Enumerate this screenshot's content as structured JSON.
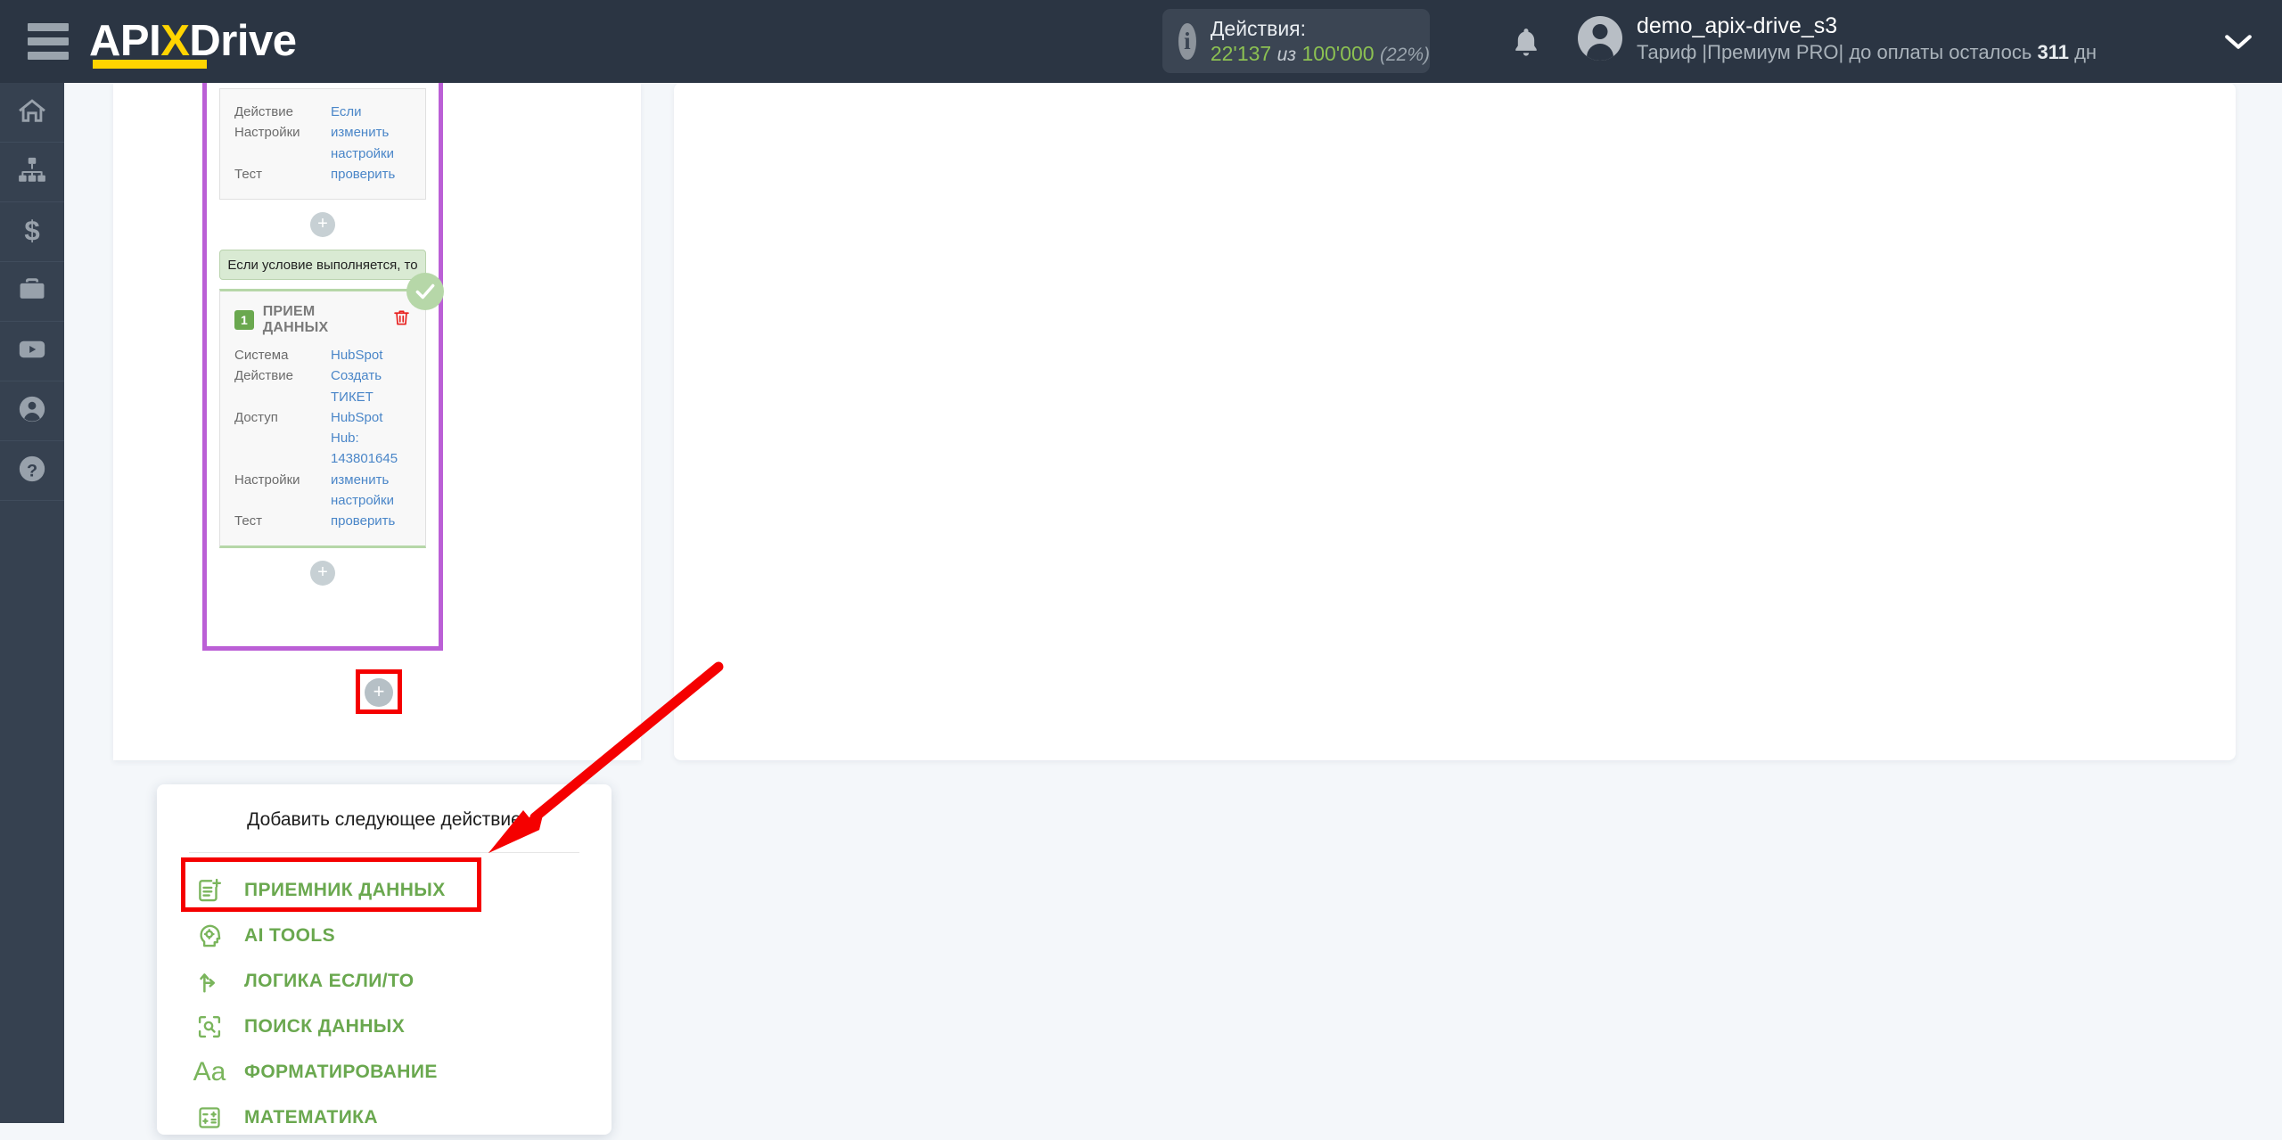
{
  "header": {
    "logo": {
      "part1": "API",
      "x": "X",
      "part2": "Drive"
    },
    "hamburger_icon": "hamburger-menu-icon",
    "actions": {
      "title": "Действия:",
      "used": "22'137",
      "separator": "из",
      "total": "100'000",
      "percent": "(22%)",
      "info_icon": "info-icon"
    },
    "bell_icon": "notification-bell-icon",
    "account": {
      "avatar_icon": "user-avatar-icon",
      "name": "demo_apix-drive_s3",
      "plan_prefix": "Тариф |Премиум PRO| до оплаты осталось ",
      "plan_days": "311",
      "plan_suffix": " дн",
      "caret_icon": "chevron-down-icon"
    }
  },
  "sidebar": {
    "items": [
      {
        "name": "home",
        "icon": "home-icon"
      },
      {
        "name": "connections",
        "icon": "sitemap-icon"
      },
      {
        "name": "billing",
        "icon": "dollar-icon"
      },
      {
        "name": "services",
        "icon": "briefcase-icon"
      },
      {
        "name": "video",
        "icon": "youtube-icon"
      },
      {
        "name": "profile",
        "icon": "user-icon"
      },
      {
        "name": "help",
        "icon": "question-circle-icon"
      }
    ]
  },
  "flow": {
    "if_node": {
      "rows": [
        {
          "key": "Действие",
          "value": "Если"
        },
        {
          "key": "Настройки",
          "value": "изменить настройки"
        },
        {
          "key": "Тест",
          "value": "проверить"
        }
      ]
    },
    "add_inside_top_label": "+",
    "condition_banner": "Если условие выполняется, то",
    "receiver_node": {
      "badge_number": "1",
      "title": "ПРИЕМ ДАННЫХ",
      "delete_icon": "trash-icon",
      "status_icon": "check-circle-icon",
      "rows": [
        {
          "key": "Система",
          "value": "HubSpot"
        },
        {
          "key": "Действие",
          "value": "Создать ТИКЕТ"
        },
        {
          "key": "Доступ",
          "value": "HubSpot Hub: 143801645"
        },
        {
          "key": "Настройки",
          "value": "изменить настройки"
        },
        {
          "key": "Тест",
          "value": "проверить"
        }
      ]
    },
    "add_inside_bottom_label": "+",
    "add_next_label": "+"
  },
  "menu": {
    "title": "Добавить следующее действие",
    "items": [
      {
        "label": "ПРИЕМНИК ДАННЫХ",
        "icon": "document-plus-icon"
      },
      {
        "label": "AI TOOLS",
        "icon": "ai-head-gear-icon"
      },
      {
        "label": "ЛОГИКА ЕСЛИ/ТО",
        "icon": "branch-arrow-icon"
      },
      {
        "label": "ПОИСК ДАННЫХ",
        "icon": "search-scan-icon"
      },
      {
        "label": "ФОРМАТИРОВАНИЕ",
        "icon": "text-format-icon"
      },
      {
        "label": "МАТЕМАТИКА",
        "icon": "calculator-icon"
      }
    ]
  },
  "annotations": {
    "highlight_plus": "red-rect-around-add-next-button",
    "highlight_logic": "red-rect-around-logic-menu-item",
    "arrow": "red-arrow-pointing-to-logic-item"
  },
  "colors": {
    "header_bg": "#2b3543",
    "rail_bg": "#364150",
    "accent_green": "#6aa84f",
    "link_blue": "#4a86c8",
    "branch_purple": "#bb5fd6",
    "annotation_red": "#f50000",
    "banner_green": "#d9ead3",
    "logo_yellow": "#ffd400"
  }
}
